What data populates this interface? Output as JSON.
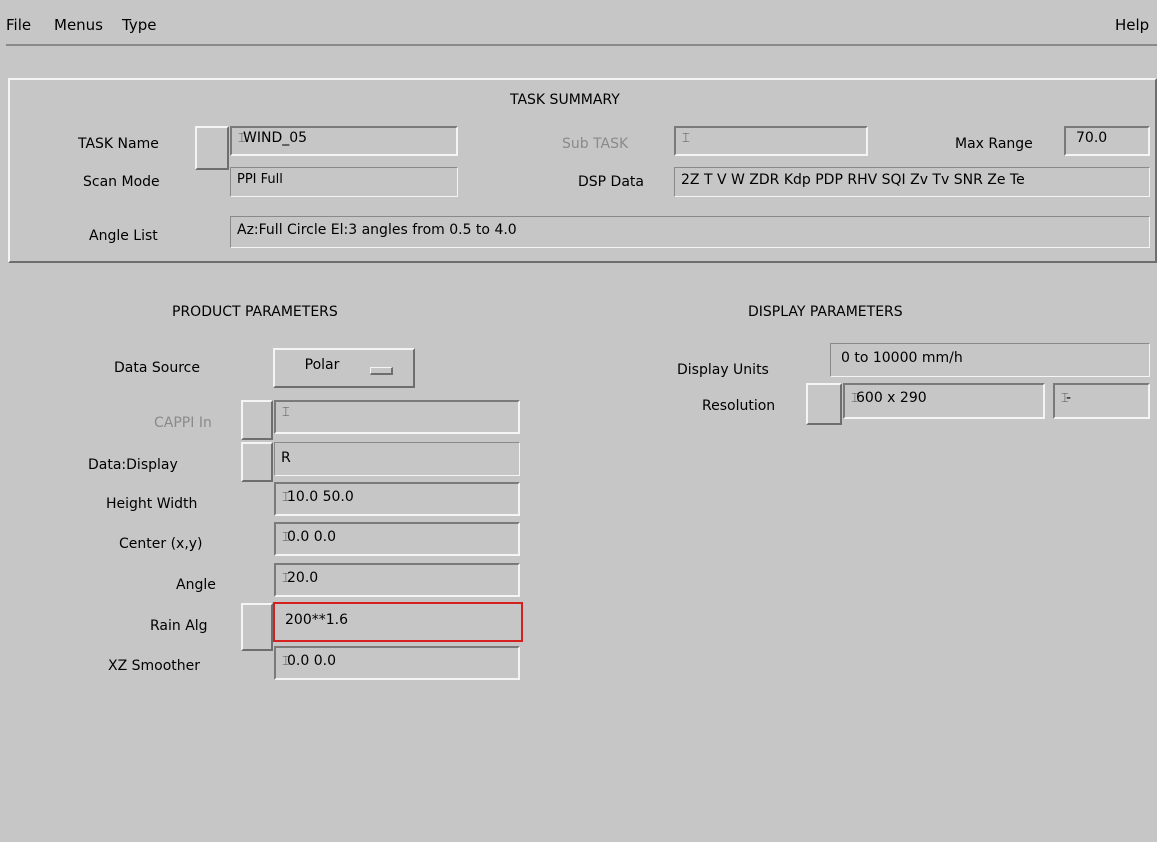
{
  "menubar": {
    "file": "File",
    "menus": "Menus",
    "type": "Type",
    "help": "Help"
  },
  "summary": {
    "title": "TASK SUMMARY",
    "task_name_label": "TASK Name",
    "task_name_value": "WIND_05",
    "sub_task_label": "Sub TASK",
    "sub_task_value": "",
    "max_range_label": "Max Range",
    "max_range_value": "70.0",
    "scan_mode_label": "Scan Mode",
    "scan_mode_value": "PPI Full",
    "dsp_data_label": "DSP Data",
    "dsp_data_value": "2Z T V W ZDR Kdp PDP RHV SQI Zv Tv SNR Ze Te",
    "angle_list_label": "Angle List",
    "angle_list_value": "Az:Full Circle   El:3 angles from 0.5 to 4.0"
  },
  "product": {
    "title": "PRODUCT PARAMETERS",
    "data_source_label": "Data Source",
    "data_source_value": "Polar",
    "cappi_in_label": "CAPPI In",
    "cappi_in_value": "",
    "data_display_label": "Data:Display",
    "data_display_value": "R",
    "height_width_label": "Height Width",
    "height_width_value": "10.0  50.0",
    "center_label": "Center (x,y)",
    "center_value": "0.0   0.0",
    "angle_label": "Angle",
    "angle_value": "20.0",
    "rain_alg_label": "Rain Alg",
    "rain_alg_value": "200**1.6",
    "xz_smoother_label": "XZ Smoother",
    "xz_smoother_value": "0.0  0.0"
  },
  "display": {
    "title": "DISPLAY PARAMETERS",
    "units_label": "Display Units",
    "units_value": "0 to 10000 mm/h",
    "resolution_label": "Resolution",
    "resolution_value": "600 x 290",
    "resolution_extra": "-"
  }
}
